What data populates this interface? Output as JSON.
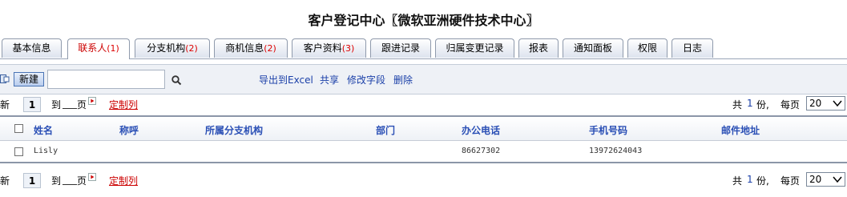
{
  "title": "客户登记中心〖微软亚洲硬件技术中心〗",
  "tabs": [
    {
      "label": "基本信息",
      "count": ""
    },
    {
      "label": "联系人",
      "count": "(1)"
    },
    {
      "label": "分支机构",
      "count": "(2)"
    },
    {
      "label": "商机信息",
      "count": "(2)"
    },
    {
      "label": "客户资料",
      "count": "(3)"
    },
    {
      "label": "跟进记录",
      "count": ""
    },
    {
      "label": "归属变更记录",
      "count": ""
    },
    {
      "label": "报表",
      "count": ""
    },
    {
      "label": "通知面板",
      "count": ""
    },
    {
      "label": "权限",
      "count": ""
    },
    {
      "label": "日志",
      "count": ""
    }
  ],
  "toolbar": {
    "new_label": "新建",
    "search_value": "",
    "export_label": "导出到Excel",
    "share_label": "共享",
    "edit_fields_label": "修改字段",
    "delete_label": "删除"
  },
  "pager": {
    "refresh_label": "新",
    "page": "1",
    "goto_label": "到",
    "page_unit": "页",
    "customize_label": "定制列",
    "total_prefix": "共",
    "total_count": "1",
    "total_suffix": "份,",
    "per_page_label": "每页",
    "per_page_value": "20"
  },
  "table": {
    "columns": [
      "姓名",
      "称呼",
      "所属分支机构",
      "部门",
      "办公电话",
      "手机号码",
      "邮件地址"
    ],
    "rows": [
      [
        "Lisly",
        "",
        "",
        "",
        "86627302",
        "13972624043",
        ""
      ]
    ]
  },
  "colors": {
    "accent_blue": "#2a4fb5",
    "link_blue": "#1a3fa8",
    "red": "#cc0000",
    "toolbar_bg": "#eef1f6"
  }
}
